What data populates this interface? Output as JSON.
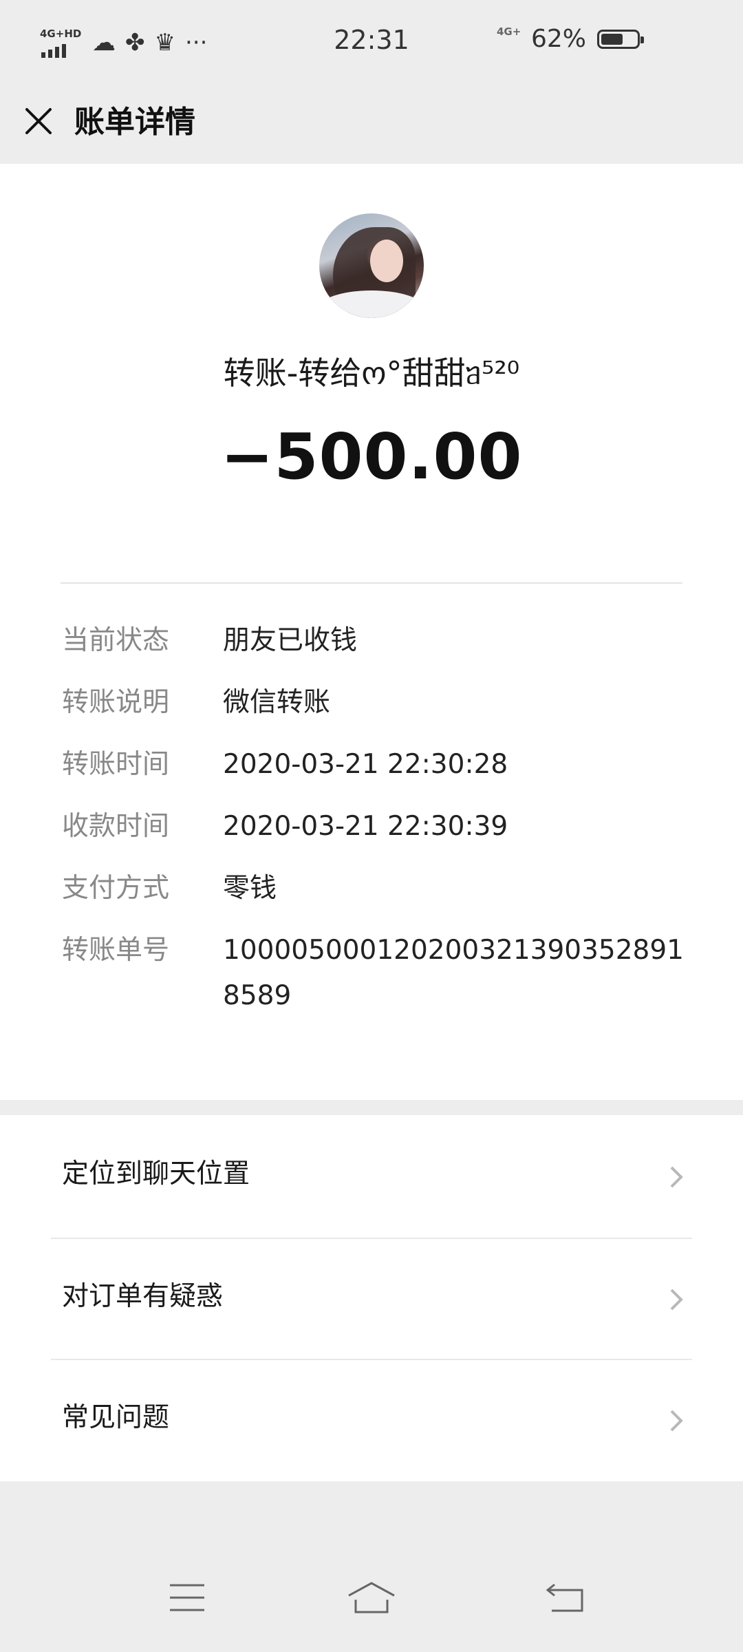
{
  "status_bar": {
    "network_label": "4G+HD",
    "time": "22:31",
    "mobile_label": "4G+",
    "battery_percent": "62%",
    "battery_level": 0.62,
    "more": "···"
  },
  "header": {
    "title": "账单详情"
  },
  "transfer": {
    "payee_text": "转账-转给ო°甜甜ᥑ⁵²⁰ ",
    "amount": "−500.00"
  },
  "details": [
    {
      "label": "当前状态",
      "value": "朋友已收钱"
    },
    {
      "label": "转账说明",
      "value": "微信转账"
    },
    {
      "label": "转账时间",
      "value": "2020-03-21 22:30:28"
    },
    {
      "label": "收款时间",
      "value": "2020-03-21 22:30:39"
    },
    {
      "label": "支付方式",
      "value": "零钱"
    },
    {
      "label": "转账单号",
      "value": "100005000120200321390352891 8589"
    }
  ],
  "menu": [
    {
      "label": "定位到聊天位置"
    },
    {
      "label": "对订单有疑惑"
    },
    {
      "label": "常见问题"
    }
  ],
  "colors": {
    "background": "#ededed",
    "card": "#ffffff",
    "label_gray": "#888888"
  }
}
